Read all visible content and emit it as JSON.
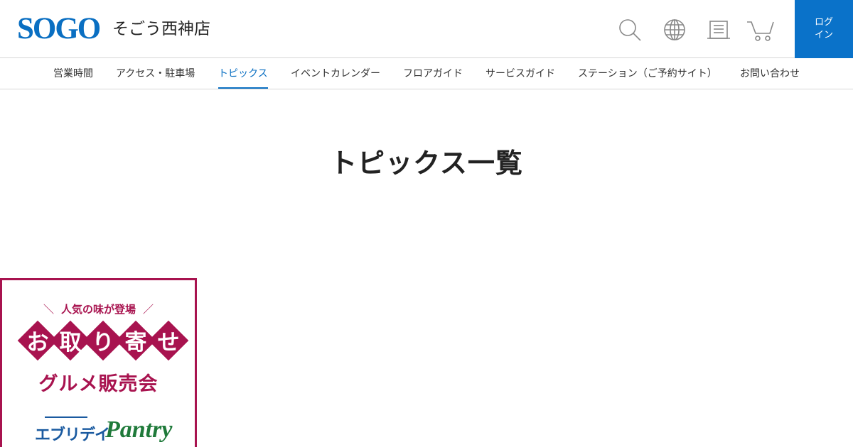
{
  "header": {
    "logo": "SOGO",
    "store_name": "そごう西神店",
    "icons": [
      "search-icon",
      "globe-icon",
      "document-icon",
      "cart-icon"
    ],
    "login": {
      "line1": "ログ",
      "line2": "イン"
    }
  },
  "nav": {
    "items": [
      {
        "label": "営業時間"
      },
      {
        "label": "アクセス・駐車場"
      },
      {
        "label": "トピックス",
        "active": true
      },
      {
        "label": "イベントカレンダー"
      },
      {
        "label": "フロアガイド"
      },
      {
        "label": "サービスガイド"
      },
      {
        "label": "ステーション（ご予約サイト）"
      },
      {
        "label": "お問い合わせ"
      }
    ]
  },
  "main": {
    "title": "トピックス一覧"
  },
  "banner": {
    "tagline": "人気の味が登場",
    "diamond_chars": [
      "お",
      "取",
      "り",
      "寄",
      "せ"
    ],
    "subtitle": "グルメ販売会",
    "brand1": "エブリデイ",
    "brand2": "Pantry"
  },
  "colors": {
    "brand_blue": "#0a6fc2",
    "banner_red": "#a8134f",
    "pantry_green": "#1f7a3a"
  }
}
